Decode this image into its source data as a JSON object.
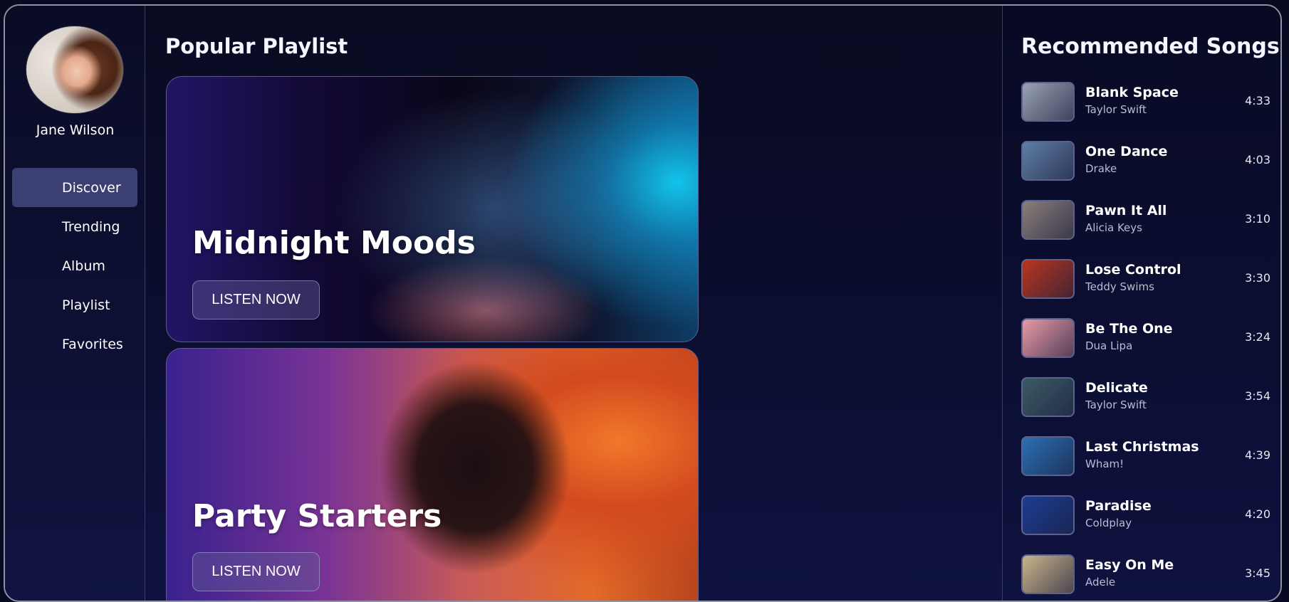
{
  "sidebar": {
    "user_name": "Jane Wilson",
    "nav": [
      {
        "label": "Discover",
        "active": true
      },
      {
        "label": "Trending",
        "active": false
      },
      {
        "label": "Album",
        "active": false
      },
      {
        "label": "Playlist",
        "active": false
      },
      {
        "label": "Favorites",
        "active": false
      }
    ]
  },
  "main": {
    "title": "Popular Playlist",
    "playlists": [
      {
        "title": "Midnight Moods",
        "button": "LISTEN NOW"
      },
      {
        "title": "Party Starters",
        "button": "LISTEN NOW"
      }
    ]
  },
  "recommended": {
    "title": "Recommended Songs",
    "songs": [
      {
        "title": "Blank Space",
        "artist": "Taylor Swift",
        "duration": "4:33",
        "thumb_color": "#9aa3b4"
      },
      {
        "title": "One Dance",
        "artist": "Drake",
        "duration": "4:03",
        "thumb_color": "#5f7fa6"
      },
      {
        "title": "Pawn It All",
        "artist": "Alicia Keys",
        "duration": "3:10",
        "thumb_color": "#8a7f7a"
      },
      {
        "title": "Lose Control",
        "artist": "Teddy Swims",
        "duration": "3:30",
        "thumb_color": "#b8361f"
      },
      {
        "title": "Be The One",
        "artist": "Dua Lipa",
        "duration": "3:24",
        "thumb_color": "#e89aa6"
      },
      {
        "title": "Delicate",
        "artist": "Taylor Swift",
        "duration": "3:54",
        "thumb_color": "#3b5b66"
      },
      {
        "title": "Last Christmas",
        "artist": "Wham!",
        "duration": "4:39",
        "thumb_color": "#2a6fb4"
      },
      {
        "title": "Paradise",
        "artist": "Coldplay",
        "duration": "4:20",
        "thumb_color": "#1c3d92"
      },
      {
        "title": "Easy On Me",
        "artist": "Adele",
        "duration": "3:45",
        "thumb_color": "#c9b48a"
      }
    ]
  }
}
